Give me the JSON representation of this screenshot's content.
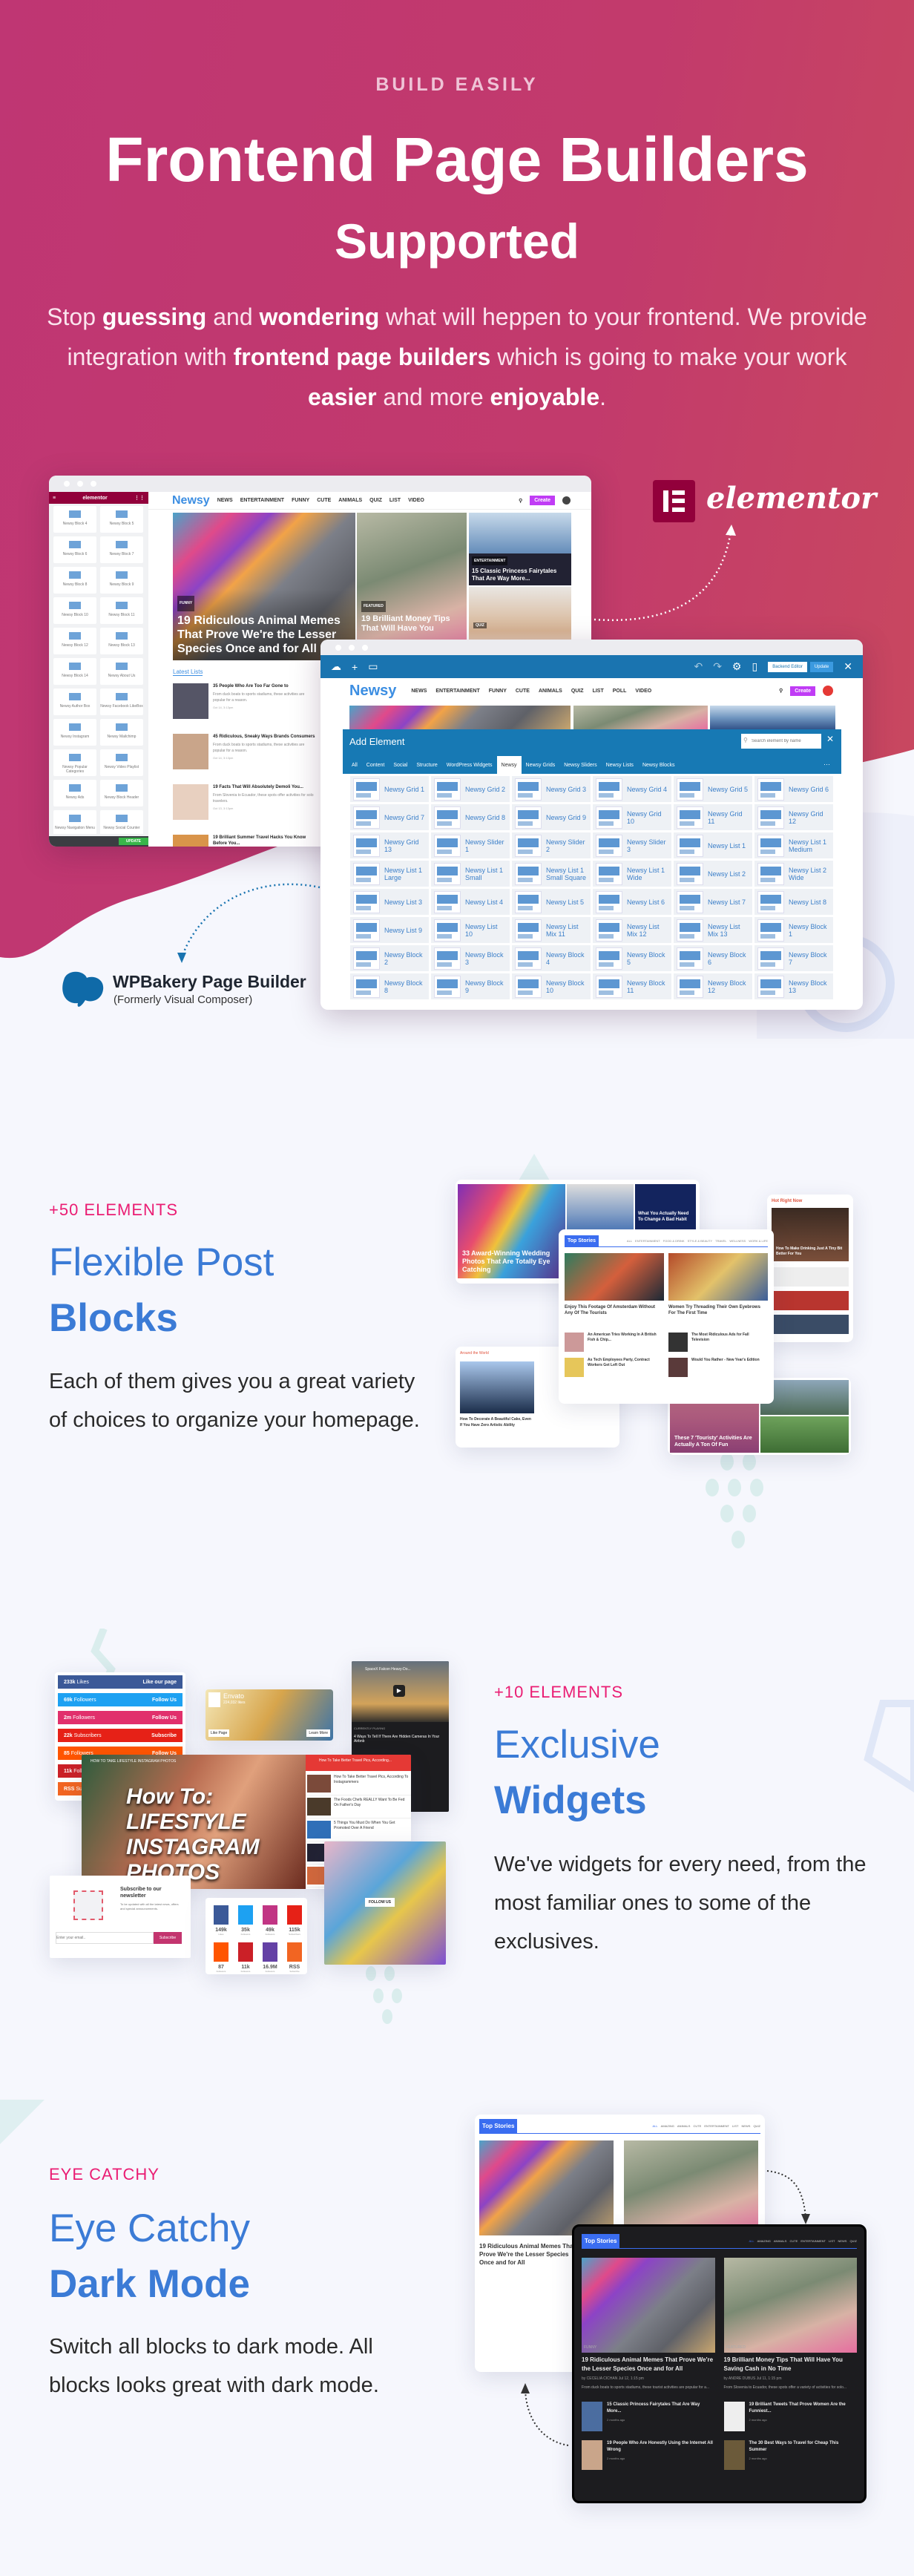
{
  "hero": {
    "eyebrow": "BUILD EASILY",
    "title": "Frontend Page Builders",
    "subtitle": "Supported",
    "description": [
      {
        "t": "Stop ",
        "b": false
      },
      {
        "t": "guessing",
        "b": true
      },
      {
        "t": " and ",
        "b": false
      },
      {
        "t": "wondering",
        "b": true
      },
      {
        "t": " what will heppen to your frontend. We provide integration with ",
        "b": false
      },
      {
        "t": "frontend page builders",
        "b": true
      },
      {
        "t": " which is going to make your work ",
        "b": false
      },
      {
        "t": "easier",
        "b": true
      },
      {
        "t": " and more ",
        "b": false
      },
      {
        "t": "enjoyable",
        "b": true
      },
      {
        "t": ".",
        "b": false
      }
    ]
  },
  "elementor_demo": {
    "sidebar_title": "elementor",
    "update_label": "UPDATE",
    "widgets": [
      "Newsy Block 4",
      "Newsy Block 5",
      "Newsy Block 6",
      "Newsy Block 7",
      "Newsy Block 8",
      "Newsy Block 9",
      "Newsy Block 10",
      "Newsy Block 11",
      "Newsy Block 12",
      "Newsy Block 13",
      "Newsy Block 14",
      "Newsy About Us",
      "Newsy Author Box",
      "Newsy Facebook LikeBox",
      "Newsy Instagram",
      "Newsy Mailchimp",
      "Newsy Popular Categories",
      "Newsy Video Playlist",
      "Newsy Ads",
      "Newsy Block Header",
      "Newsy Navigation Menu",
      "Newsy Social Counter"
    ],
    "logo": "Newsy",
    "menu": [
      "NEWS",
      "ENTERTAINMENT",
      "FUNNY",
      "CUTE",
      "ANIMALS",
      "QUIZ",
      "LIST",
      "VIDEO"
    ],
    "create_label": "Create",
    "posts": [
      {
        "category": "FUNNY",
        "title": "19 Ridiculous Animal Memes That Prove We're the Lesser Species Once and for All"
      },
      {
        "category": "FEATURED",
        "title": "19 Brilliant Money Tips That Will Have You"
      },
      {
        "category": "ENTERTAINMENT",
        "title": "15 Classic Princess Fairytales That Are Way More..."
      },
      {
        "category": "QUIZ",
        "title": ""
      }
    ],
    "latest_label": "Latest Lists",
    "list": [
      {
        "title": "35 People Who Are Too Far Gone to",
        "excerpt": "From duck boats to sports stadiums, these activities are popular for a reason.",
        "meta": "Oct 14, 3:13pm"
      },
      {
        "title": "45 Ridiculous, Sneaky Ways Brands Consumers",
        "excerpt": "From duck boats to sports stadiums, these activities are popular for a reason.",
        "meta": "Oct 14, 3:13pm"
      },
      {
        "title": "19 Facts That Will Absolutely Demoli You...",
        "excerpt": "From Slovenia to Ecuador, these spots offer activities for solo travelers.",
        "meta": "Oct 13, 3:13pm"
      },
      {
        "title": "19 Brilliant Summer Travel Hacks You Know Before You...",
        "excerpt": "",
        "meta": ""
      }
    ]
  },
  "elementor_brand": {
    "name": "elementor",
    "color": "#92003b"
  },
  "wpbakery_demo": {
    "backend_label": "Backend Editor",
    "update_label": "Update",
    "logo": "Newsy",
    "menu": [
      "NEWS",
      "ENTERTAINMENT",
      "FUNNY",
      "CUTE",
      "ANIMALS",
      "QUIZ",
      "LIST",
      "POLL",
      "VIDEO"
    ],
    "create_label": "Create",
    "panel_title": "Add Element",
    "search_placeholder": "Search element by name",
    "tabs": [
      "All",
      "Content",
      "Social",
      "Structure",
      "WordPress Widgets",
      "Newsy",
      "Newsy Grids",
      "Newsy Sliders",
      "Newsy Lists",
      "Newsy Blocks"
    ],
    "active_tab": "Newsy",
    "elements": [
      "Newsy Grid 1",
      "Newsy Grid 2",
      "Newsy Grid 3",
      "Newsy Grid 4",
      "Newsy Grid 5",
      "Newsy Grid 6",
      "Newsy Grid 7",
      "Newsy Grid 8",
      "Newsy Grid 9",
      "Newsy Grid 10",
      "Newsy Grid 11",
      "Newsy Grid 12",
      "Newsy Grid 13",
      "Newsy Slider 1",
      "Newsy Slider 2",
      "Newsy Slider 3",
      "Newsy List 1",
      "Newsy List 1 Medium",
      "Newsy List 1 Large",
      "Newsy List 1 Small",
      "Newsy List 1 Small Square",
      "Newsy List 1 Wide",
      "Newsy List 2",
      "Newsy List 2 Wide",
      "Newsy List 3",
      "Newsy List 4",
      "Newsy List 5",
      "Newsy List 6",
      "Newsy List 7",
      "Newsy List 8",
      "Newsy List 9",
      "Newsy List 10",
      "Newsy List Mix 11",
      "Newsy List Mix 12",
      "Newsy List Mix 13",
      "Newsy Block 1",
      "Newsy Block 2",
      "Newsy Block 3",
      "Newsy Block 4",
      "Newsy Block 5",
      "Newsy Block 6",
      "Newsy Block 7",
      "Newsy Block 8",
      "Newsy Block 9",
      "Newsy Block 10",
      "Newsy Block 11",
      "Newsy Block 12",
      "Newsy Block 13"
    ]
  },
  "wpbakery_brand": {
    "name": "WPBakery Page Builder",
    "subtitle": "(Formerly Visual Composer)",
    "color": "#0f6aa8"
  },
  "sections": [
    {
      "eyebrow": "+50 ELEMENTS",
      "title_light": "Flexible Post",
      "title_bold": "Blocks",
      "description": "Each of them gives you a great variety of choices to organize your homepage."
    },
    {
      "eyebrow": "+10 ELEMENTS",
      "title_light": "Exclusive",
      "title_bold": "Widgets",
      "description": "We've widgets for every need, from the most familiar ones to some of the exclusives."
    },
    {
      "eyebrow": "EYE CATCHY",
      "title_light": "Eye Catchy",
      "title_bold": "Dark Mode",
      "description": "Switch all blocks to dark mode. All blocks looks great with dark mode."
    }
  ],
  "blocks_demo": {
    "feature_title": "33 Award-Winning Wedding Photos That Are Totally Eye Catching",
    "side_title": "What You Actually Need To Change A Bad Habit",
    "top_stories": "Top Stories",
    "filters": [
      "ALL",
      "ENTERTAINMENT",
      "FOOD & DRINK",
      "STYLE & BEAUTY",
      "TRAVEL",
      "WELLNESS",
      "WORK & LIFE"
    ],
    "posts": [
      "Enjoy This Footage Of Amsterdam Without Any Of The Tourists",
      "Women Try Threading Their Own Eyebrows For The First Time"
    ],
    "small_posts": [
      "An American Tries Working In A British Fish & Chip...",
      "The Most Ridiculous Ads for Fall Television",
      "As Tech Employees Party, Contract Workers Get Left Out",
      "Would You Rather - New Year's Edition"
    ],
    "hot_label": "Hot Right Now",
    "hot_title": "How To Make Drinking Just A Tiny Bit Better For You",
    "world_label": "Around the World",
    "world_title": "How To Decorate A Beautiful Cake, Even If You Have Zero Artistic Ability",
    "bottom_title": "These 7 'Touristy' Activities Are Actually A Ton Of Fun"
  },
  "widgets_demo": {
    "social": [
      {
        "count": "233k",
        "unit": "Likes",
        "action": "Like our page",
        "color": "#3b5998"
      },
      {
        "count": "69k",
        "unit": "Followers",
        "action": "Follow Us",
        "color": "#1da1f2"
      },
      {
        "count": "2m",
        "unit": "Followers",
        "action": "Follow Us",
        "color": "#e1306c"
      },
      {
        "count": "22k",
        "unit": "Subscribers",
        "action": "Subscribe",
        "color": "#e62117"
      },
      {
        "count": "85",
        "unit": "Followers",
        "action": "Follow Us",
        "color": "#ff5500"
      },
      {
        "count": "11k",
        "unit": "Followers",
        "action": "Follow Us",
        "color": "#cb2027"
      },
      {
        "count": "RSS",
        "unit": "Subscribe",
        "action": "Subscribe",
        "color": "#f26522"
      }
    ],
    "fb_name": "Envato",
    "fb_likes": "224,032 likes",
    "fb_like": "Like Page",
    "fb_more": "Learn More",
    "video_title": "SpaceX Falcon Heavy-Do...",
    "now_playing": "CURRENTLY PLAYING",
    "playing_title": "4 Ways To Tell If There Are Hidden Cameras In Your Airbnb",
    "big_video_title": "HOW TO TAKE LIFESTYLE INSTAGRAM PHOTOS",
    "big_video_text": "How To: LIFESTYLE INSTAGRAM PHOTOS",
    "playlist": [
      "How To Take Better Travel Pics, According To Instagrammers",
      "The Foods Chefs REALLY Want To Be Fed On Father's Day",
      "5 Things You Must Do When You Get Promoted Over A Friend",
      "This Manager Won't Hire You Unless You Write A...",
      "6 Messages Bad Bosses Use To Manipulate You Into Compliance"
    ],
    "playlist_header": "How To Take Better Travel Pics, According...",
    "newsletter_title": "Subscribe to our newsletter",
    "newsletter_text": "To be updated with all the latest news, offers and special announcements.",
    "newsletter_placeholder": "Enter your email..",
    "newsletter_button": "Subscribe",
    "counters": [
      {
        "v": "149k",
        "u": "Likes",
        "color": "#3b5998"
      },
      {
        "v": "35k",
        "u": "Followers",
        "color": "#1da1f2"
      },
      {
        "v": "49k",
        "u": "Followers",
        "color": "#c13584"
      },
      {
        "v": "115k",
        "u": "Subscribers",
        "color": "#e62117"
      },
      {
        "v": "87",
        "u": "Followers",
        "color": "#ff5500"
      },
      {
        "v": "11k",
        "u": "Followers",
        "color": "#cb2027"
      },
      {
        "v": "16.9M",
        "u": "Followers",
        "color": "#6441a5"
      },
      {
        "v": "RSS",
        "u": "Subscribe",
        "color": "#f26522"
      }
    ],
    "instagram_follow": "FOLLOW US"
  },
  "dark_demo": {
    "top_stories": "Top Stories",
    "filters": [
      "ALL",
      "AMAZING",
      "ANIMALS",
      "CUTE",
      "ENTERTAINMENT",
      "LIST",
      "NEWS",
      "QUIZ"
    ],
    "posts": [
      {
        "category": "FUNNY",
        "title": "19 Ridiculous Animal Memes That Prove We're the Lesser Species Once and for All",
        "author": "by CECELIA CICHAN",
        "date": "Jul 12, 1:15 pm",
        "excerpt": "From duck boats to sports stadiums, these tourist activities are popular for a..."
      },
      {
        "category": "FEATURED",
        "title": "19 Brilliant Money Tips That Will Have You Saving Cash in No Time",
        "author": "by ANDRE DUBUS",
        "date": "Jul 11, 1:15 pm",
        "excerpt": "From Slovenia to Ecuador, these spots offer a variety of activities for solo..."
      }
    ],
    "small": [
      {
        "title": "15 Classic Princess Fairytales That Are Way More...",
        "meta": "2 months ago"
      },
      {
        "title": "19 Brilliant Tweets That Prove Women Are the Funniest...",
        "meta": "2 months ago"
      },
      {
        "title": "19 People Who Are Honestly Using the Internet All Wrong",
        "meta": "2 months ago"
      },
      {
        "title": "The 30 Best Ways to Travel for Cheap This Summer",
        "meta": "2 months ago"
      }
    ]
  },
  "colors": {
    "hero_start": "#bf3673",
    "hero_end": "#c9495e",
    "accent_pink": "#ea1d73",
    "heading_blue": "#3b7bd6",
    "page_bg": "#f6f7fd"
  }
}
